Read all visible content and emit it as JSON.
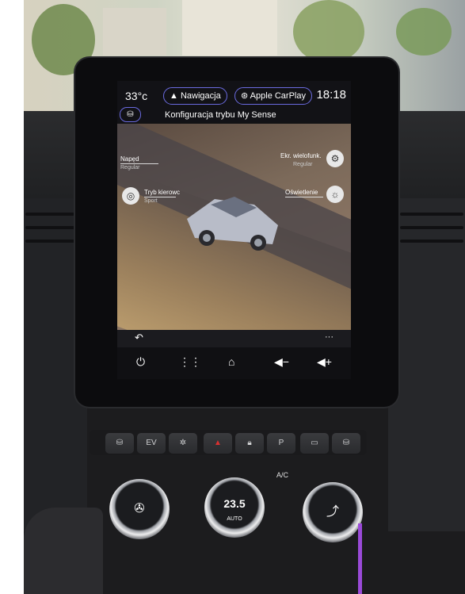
{
  "status_bar": {
    "temperature": "33°c",
    "navigation_label": "Nawigacja",
    "carplay_label": "Apple CarPlay",
    "time": "18:18"
  },
  "screen_title": "Konfiguracja trybu My Sense",
  "settings": {
    "naped": {
      "label": "Napęd",
      "value": "Regular"
    },
    "tryb_kierowcy": {
      "label": "Tryb kierowc",
      "value": "Sport"
    },
    "ekran_wielofunkc": {
      "label": "Ekr. wielofunk.",
      "value": "Regular"
    },
    "oswietlenie": {
      "label": "Oświetlenie",
      "value": ""
    }
  },
  "action_bar": {
    "more": "···"
  },
  "climate": {
    "temperature_display": "23.5",
    "auto_label": "AUTO",
    "ac_label": "A/C",
    "ev_label": "EV"
  },
  "colors": {
    "accent_pill_border": "#6a6adf",
    "ambient_light": "#9a4ad8",
    "hazard": "#d93030"
  },
  "icons": [
    "back-arrow-icon",
    "power-icon",
    "apps-grid-icon",
    "home-icon",
    "volume-down-icon",
    "volume-up-icon",
    "navigation-arrow-icon",
    "carplay-icon",
    "seat-icon",
    "steering-wheel-icon",
    "multisense-icon",
    "lighting-icon",
    "fan-icon",
    "air-flow-icon"
  ]
}
